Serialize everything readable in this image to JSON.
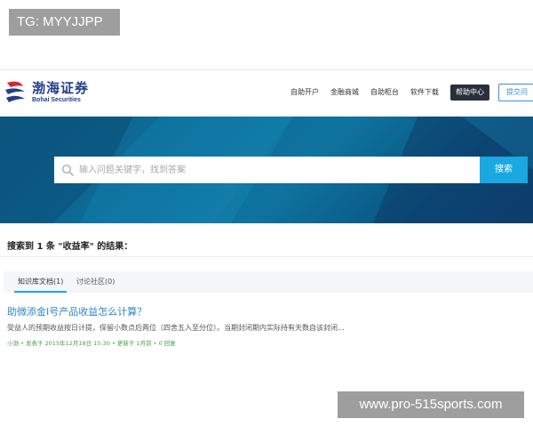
{
  "overlay": {
    "tg_label": "TG: MYYJJPP",
    "watermark_text": "www.pro-515sports.com"
  },
  "header": {
    "logo_cn": "渤海证券",
    "logo_en": "Bohai Securities",
    "nav": [
      {
        "label": "自助开户"
      },
      {
        "label": "金融商城"
      },
      {
        "label": "自助柜台"
      },
      {
        "label": "软件下载"
      },
      {
        "label": "帮助中心"
      },
      {
        "label": "提交问"
      }
    ]
  },
  "search": {
    "placeholder": "输入问题关键字，找到答案",
    "value": "",
    "button_label": "搜索"
  },
  "results": {
    "summary": "搜索到 1 条 \"收益率\" 的结果：",
    "tabs": [
      {
        "label": "知识库文档(1)",
        "active": true
      },
      {
        "label": "讨论社区(0)",
        "active": false
      }
    ],
    "items": [
      {
        "title": "助微添金I号产品收益怎么计算？",
        "snippet": "受益人的预期收益按日计提，保留小数点后两位（四舍五入至分位）。当期封闭期内实际持有天数自该封闭...",
        "meta": "小渤 • 发表于 2015年12月18日 15:30 • 更新于 1月前 • 0 回复"
      }
    ]
  },
  "colors": {
    "brand_blue": "#233e8b",
    "accent": "#19a9e0",
    "link": "#2e86c8",
    "meta_green": "#4aa04a",
    "help_bg": "#2b2f3a"
  }
}
